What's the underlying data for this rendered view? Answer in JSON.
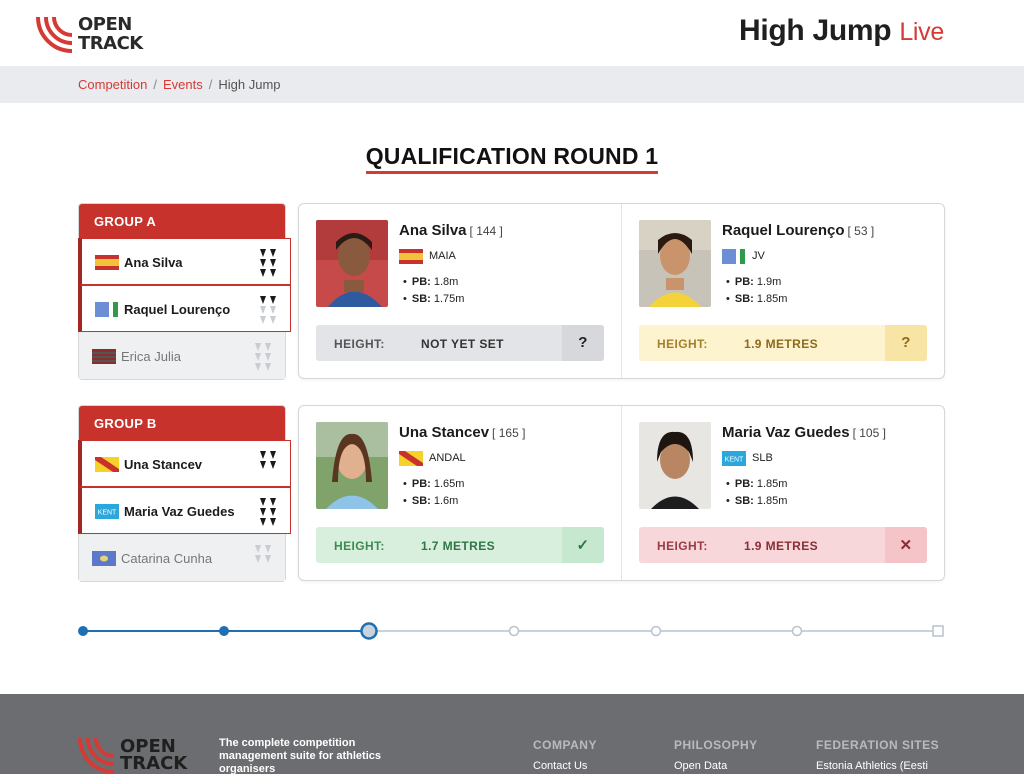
{
  "header": {
    "logo_line1": "OPEN",
    "logo_line2": "TRACK",
    "title": "High Jump",
    "title_suffix": "Live",
    "brand_color": "#d63a35"
  },
  "breadcrumb": {
    "items": [
      "Competition",
      "Events",
      "High Jump"
    ],
    "separator": "/"
  },
  "round_title": "QUALIFICATION ROUND 1",
  "groups": [
    {
      "label": "GROUP A",
      "athletes": [
        {
          "name": "Ana Silva",
          "flag": "spain-flag",
          "active": true
        },
        {
          "name": "Raquel Lourenço",
          "flag": "blue-green-flag",
          "active": true
        },
        {
          "name": "Erica Julia",
          "flag": "striped-red-flag",
          "active": false
        }
      ],
      "cards": [
        {
          "name": "Ana Silva",
          "bib": "[ 144 ]",
          "club": "MAIA",
          "flag": "spain-flag",
          "pb_label": "PB:",
          "pb": "1.8m",
          "sb_label": "SB:",
          "sb": "1.75m",
          "height_label": "HEIGHT:",
          "height_value": "NOT YET SET",
          "status": "?",
          "status_style": "pending"
        },
        {
          "name": "Raquel Lourenço",
          "bib": "[ 53 ]",
          "club": "JV",
          "flag": "blue-green-flag",
          "pb_label": "PB:",
          "pb": "1.9m",
          "sb_label": "SB:",
          "sb": "1.85m",
          "height_label": "HEIGHT:",
          "height_value": "1.9 METRES",
          "status": "?",
          "status_style": "waiting"
        }
      ]
    },
    {
      "label": "GROUP B",
      "athletes": [
        {
          "name": "Una Stancev",
          "flag": "yellow-red-diagonal-flag",
          "active": true
        },
        {
          "name": "Maria Vaz Guedes",
          "flag": "kent-flag",
          "flag_text": "KENT",
          "active": true
        },
        {
          "name": "Catarina Cunha",
          "flag": "blue-crest-flag",
          "active": false
        }
      ],
      "cards": [
        {
          "name": "Una Stancev",
          "bib": "[ 165 ]",
          "club": "ANDAL",
          "flag": "yellow-red-diagonal-flag",
          "pb_label": "PB:",
          "pb": "1.65m",
          "sb_label": "SB:",
          "sb": "1.6m",
          "height_label": "HEIGHT:",
          "height_value": "1.7 METRES",
          "status": "✓",
          "status_style": "cleared"
        },
        {
          "name": "Maria Vaz Guedes",
          "bib": "[ 105 ]",
          "club": "SLB",
          "flag": "kent-flag",
          "flag_text": "KENT",
          "pb_label": "PB:",
          "pb": "1.85m",
          "sb_label": "SB:",
          "sb": "1.85m",
          "height_label": "HEIGHT:",
          "height_value": "1.9 METRES",
          "status": "✕",
          "status_style": "failed"
        }
      ]
    }
  ],
  "progress": {
    "total_steps": 7,
    "completed_steps": 2,
    "current_step": 3
  },
  "footer": {
    "logo_line1": "OPEN",
    "logo_line2": "TRACK",
    "tagline": "The complete competition management suite for athletics organisers",
    "columns": [
      {
        "heading": "COMPANY",
        "link": "Contact Us"
      },
      {
        "heading": "PHILOSOPHY",
        "link": "Open Data"
      },
      {
        "heading": "FEDERATION SITES",
        "link": "Estonia Athletics (Eesti"
      }
    ]
  }
}
